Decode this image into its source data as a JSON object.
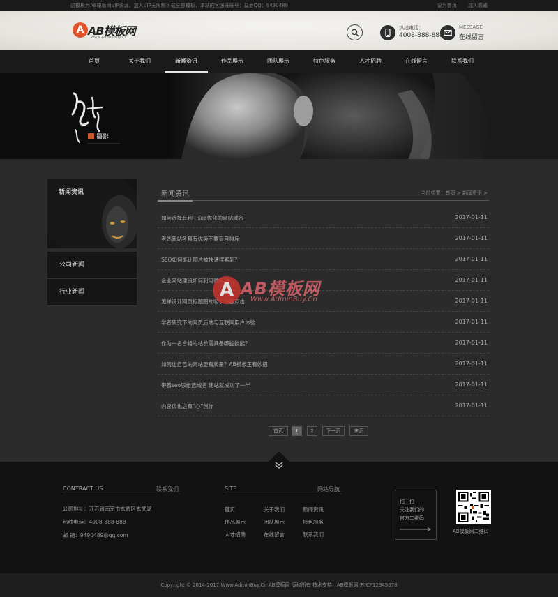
{
  "topbar": {
    "notice": "这模板为AB模板网VIP资源，加入VIP无限制下载全部模板，本站的客服旺旺号：莫爱QQ：9490489",
    "links": [
      "设为首页",
      "加入收藏"
    ]
  },
  "header": {
    "logo_mark": "A",
    "logo_name": "AB模板网",
    "logo_sub": "Www.AdminBuy.Cn",
    "phone_label": "热线电话：",
    "phone_value": "4008-888-888",
    "message_label": "MESSAGE",
    "message_value": "在线留言"
  },
  "nav": {
    "items": [
      "首页",
      "关于我们",
      "新闻资讯",
      "作品展示",
      "团队展示",
      "特色服务",
      "人才招聘",
      "在线留言",
      "联系我们"
    ],
    "active_index": 2
  },
  "banner": {
    "brand_text": "摄影"
  },
  "sidebar": {
    "title": "新闻资讯",
    "items": [
      "公司新闻",
      "行业新闻"
    ]
  },
  "content": {
    "title": "新闻资讯",
    "crumb_prefix": "当前位置：",
    "crumb_home": "首页",
    "crumb_sep": " > ",
    "crumb_current": "新闻资讯",
    "crumb_tail": " >",
    "news": [
      {
        "title": "如何选择有利于seo优化的网站域名",
        "date": "2017-01-11"
      },
      {
        "title": "老站新站各具有优势不要盲目排斥",
        "date": "2017-01-11"
      },
      {
        "title": "SEO如何能让图片被快速搜索到？",
        "date": "2017-01-11"
      },
      {
        "title": "企业网站建设如何利用微网站",
        "date": "2017-01-11"
      },
      {
        "title": "怎样设计网页标题图片吸引访客点击",
        "date": "2017-01-11"
      },
      {
        "title": "学者研究下的网页后端与互联网用户体验",
        "date": "2017-01-11"
      },
      {
        "title": "作为一名合格的站长需具备哪些技能？",
        "date": "2017-01-11"
      },
      {
        "title": "如何让自己的网站更有质量？AB模板王有妙招",
        "date": "2017-01-11"
      },
      {
        "title": "带着seo思维选域名 建站就成功了一半",
        "date": "2017-01-11"
      },
      {
        "title": "内容优化之有“心”创作",
        "date": "2017-01-11"
      }
    ],
    "pager": {
      "first": "首页",
      "pages": [
        "1",
        "2"
      ],
      "current": "1",
      "next": "下一页",
      "last": "末页"
    }
  },
  "watermark": {
    "mark": "A",
    "name": "AB模板网",
    "url": "Www.AdminBuy.Cn"
  },
  "footer": {
    "contact_title": "CONTRACT US",
    "contact_more": "联系我们",
    "address": "公司地址：江苏省南京市玄武区玄武湖",
    "phone": "热线电话：4008-888-888",
    "email_label": "邮      箱：",
    "email": "9490489@qq.com",
    "site_title": "SITE",
    "site_more": "网站导航",
    "site_links": [
      "首页",
      "关于我们",
      "新闻资讯",
      "作品展示",
      "团队展示",
      "特色服务",
      "人才招聘",
      "在线留言",
      "联系我们"
    ],
    "qr_text_1": "扫一扫",
    "qr_text_2": "关注我们的",
    "qr_text_3": "官方二维码",
    "qr_caption": "AB模板网二维码"
  },
  "copyright": "Copyright © 2014-2017 Www.AdminBuy.Cn AB模板网 版权所有     技术支持：AB模板网     苏ICP12345678"
}
